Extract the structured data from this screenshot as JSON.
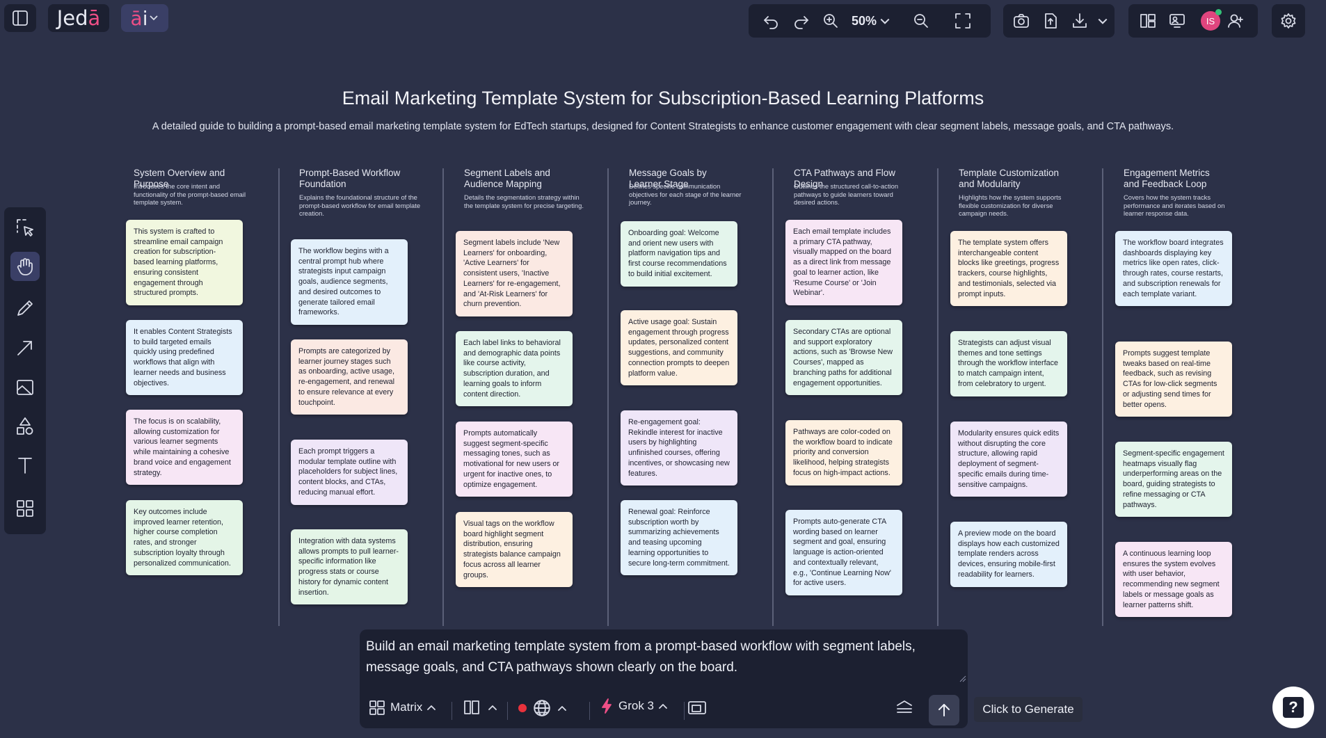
{
  "app": {
    "logo_text": "Jedā",
    "ai_label": "āi",
    "zoom_level": "50%"
  },
  "user": {
    "initials": "IS"
  },
  "board": {
    "title": "Email Marketing Template System for Subscription-Based Learning Platforms",
    "subtitle": "A detailed guide to building a prompt-based email marketing template system for EdTech startups, designed for Content Strategists to enhance customer engagement with clear segment labels, message goals, and CTA pathways.",
    "columns": [
      {
        "heading": "System Overview and Purpose",
        "description": "Introduces the core intent and functionality of the prompt-based email template system.",
        "cards": [
          {
            "text": "This system is crafted to streamline email campaign creation for subscription-based learning platforms, ensuring consistent engagement through structured prompts.",
            "color": "#f1f7df"
          },
          {
            "text": "It enables Content Strategists to build targeted emails quickly using predefined workflows that align with learner needs and business objectives.",
            "color": "#e3f0fb"
          },
          {
            "text": "The focus is on scalability, allowing customization for various learner segments while maintaining a cohesive brand voice and engagement strategy.",
            "color": "#f7e6f5"
          },
          {
            "text": "Key outcomes include improved learner retention, higher course completion rates, and stronger subscription loyalty through personalized communication.",
            "color": "#e4f5e7"
          }
        ]
      },
      {
        "heading": "Prompt-Based Workflow Foundation",
        "description": "Explains the foundational structure of the prompt-based workflow for email template creation.",
        "cards": [
          {
            "text": "The workflow begins with a central prompt hub where strategists input campaign goals, audience segments, and desired outcomes to generate tailored email frameworks.",
            "color": "#e3f0fb"
          },
          {
            "text": "Prompts are categorized by learner journey stages such as onboarding, active usage, re-engagement, and renewal to ensure relevance at every touchpoint.",
            "color": "#fbe9e3"
          },
          {
            "text": "Each prompt triggers a modular template outline with placeholders for subject lines, content blocks, and CTAs, reducing manual effort.",
            "color": "#efe6f8"
          },
          {
            "text": "Integration with data systems allows prompts to pull learner-specific information like progress stats or course history for dynamic content insertion.",
            "color": "#e4f5e7"
          }
        ]
      },
      {
        "heading": "Segment Labels and Audience Mapping",
        "description": "Details the segmentation strategy within the template system for precise targeting.",
        "cards": [
          {
            "text": "Segment labels include 'New Learners' for onboarding, 'Active Learners' for consistent users, 'Inactive Learners' for re-engagement, and 'At-Risk Learners' for churn prevention.",
            "color": "#fbe9e3"
          },
          {
            "text": "Each label links to behavioral and demographic data points like course activity, subscription duration, and learning goals to inform content direction.",
            "color": "#e4f5ec"
          },
          {
            "text": "Prompts automatically suggest segment-specific messaging tones, such as motivational for new users or urgent for inactive ones, to optimize engagement.",
            "color": "#f7e6f5"
          },
          {
            "text": "Visual tags on the workflow board highlight segment distribution, ensuring strategists balance campaign focus across all learner groups.",
            "color": "#fdf0e1"
          }
        ]
      },
      {
        "heading": "Message Goals by Learner Stage",
        "description": "Defines specific communication objectives for each stage of the learner journey.",
        "cards": [
          {
            "text": "Onboarding goal: Welcome and orient new users with platform navigation tips and first course recommendations to build initial excitement.",
            "color": "#e4f5ec"
          },
          {
            "text": "Active usage goal: Sustain engagement through progress updates, personalized content suggestions, and community connection prompts to deepen platform value.",
            "color": "#fdf0e1"
          },
          {
            "text": "Re-engagement goal: Rekindle interest for inactive users by highlighting unfinished courses, offering incentives, or showcasing new features.",
            "color": "#efe6f8"
          },
          {
            "text": "Renewal goal: Reinforce subscription worth by summarizing achievements and teasing upcoming learning opportunities to secure long-term commitment.",
            "color": "#e3f0fb"
          }
        ]
      },
      {
        "heading": "CTA Pathways and Flow Design",
        "description": "Outlines the structured call-to-action pathways to guide learners toward desired actions.",
        "cards": [
          {
            "text": "Each email template includes a primary CTA pathway, visually mapped on the board as a direct link from message goal to learner action, like 'Resume Course' or 'Join Webinar'.",
            "color": "#f7e6f5"
          },
          {
            "text": "Secondary CTAs are optional and support exploratory actions, such as 'Browse New Courses', mapped as branching paths for additional engagement opportunities.",
            "color": "#e4f5ec"
          },
          {
            "text": "Pathways are color-coded on the workflow board to indicate priority and conversion likelihood, helping strategists focus on high-impact actions.",
            "color": "#fdf0e1"
          },
          {
            "text": "Prompts auto-generate CTA wording based on learner segment and goal, ensuring language is action-oriented and contextually relevant, e.g., 'Continue Learning Now' for active users.",
            "color": "#e3f0fb"
          }
        ]
      },
      {
        "heading": "Template Customization and Modularity",
        "description": "Highlights how the system supports flexible customization for diverse campaign needs.",
        "cards": [
          {
            "text": "The template system offers interchangeable content blocks like greetings, progress trackers, course highlights, and testimonials, selected via prompt inputs.",
            "color": "#fdf0e1"
          },
          {
            "text": "Strategists can adjust visual themes and tone settings through the workflow interface to match campaign intent, from celebratory to urgent.",
            "color": "#e4f5ec"
          },
          {
            "text": "Modularity ensures quick edits without disrupting the core structure, allowing rapid deployment of segment-specific emails during time-sensitive campaigns.",
            "color": "#efe6f8"
          },
          {
            "text": "A preview mode on the board displays how each customized template renders across devices, ensuring mobile-first readability for learners.",
            "color": "#e3f0fb"
          }
        ]
      },
      {
        "heading": "Engagement Metrics and Feedback Loop",
        "description": "Covers how the system tracks performance and iterates based on learner response data.",
        "cards": [
          {
            "text": "The workflow board integrates dashboards displaying key metrics like open rates, click-through rates, course restarts, and subscription renewals for each template variant.",
            "color": "#e3f0fb"
          },
          {
            "text": "Prompts suggest template tweaks based on real-time feedback, such as revising CTAs for low-click segments or adjusting send times for better opens.",
            "color": "#fdf0e1"
          },
          {
            "text": "Segment-specific engagement heatmaps visually flag underperforming areas on the board, guiding strategists to refine messaging or CTA pathways.",
            "color": "#e4f5ec"
          },
          {
            "text": "A continuous learning loop ensures the system evolves with user behavior, recommending new segment labels or message goals as learner patterns shift.",
            "color": "#f7e6f5"
          }
        ]
      }
    ]
  },
  "prompt": {
    "text": "Build an email marketing template system from a prompt-based workflow with segment labels, message goals, and CTA pathways shown clearly on the board.",
    "layout_label": "Matrix",
    "model_label": "Grok 3",
    "record_color": "#e8323c"
  },
  "tooltip": {
    "generate": "Click to Generate"
  },
  "help": {
    "label": "?"
  },
  "icons": [
    "sidebar-toggle-icon",
    "undo-icon",
    "redo-icon",
    "zoom-in-icon",
    "zoom-out-icon",
    "fit-screen-icon",
    "camera-icon",
    "upload-icon",
    "download-icon",
    "layout-icon",
    "present-icon",
    "add-user-icon",
    "settings-icon",
    "select-icon",
    "hand-icon",
    "pencil-icon",
    "arrow-icon",
    "image-icon",
    "shapes-icon",
    "text-icon",
    "grid-icon",
    "matrix-icon",
    "panels-icon",
    "globe-icon",
    "bolt-icon",
    "frame-icon",
    "layers-icon",
    "send-arrow-icon",
    "help-icon"
  ]
}
